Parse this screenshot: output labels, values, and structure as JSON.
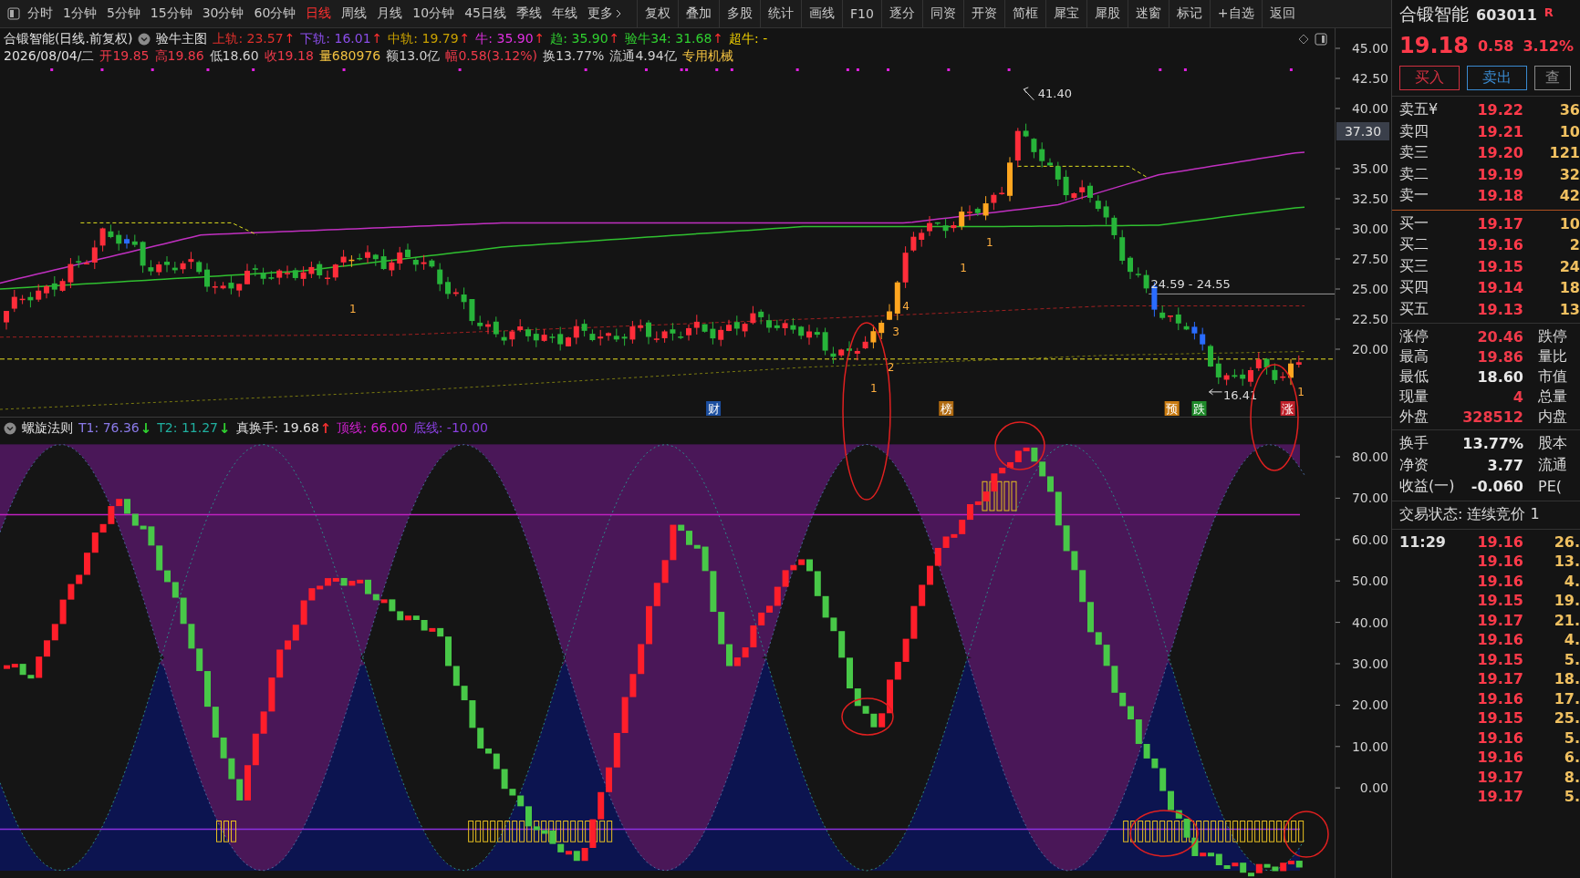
{
  "toolbar": {
    "periods": [
      {
        "label": "分时",
        "selected": false
      },
      {
        "label": "1分钟",
        "selected": false
      },
      {
        "label": "5分钟",
        "selected": false
      },
      {
        "label": "15分钟",
        "selected": false
      },
      {
        "label": "30分钟",
        "selected": false
      },
      {
        "label": "60分钟",
        "selected": false
      },
      {
        "label": "日线",
        "selected": true
      },
      {
        "label": "周线",
        "selected": false
      },
      {
        "label": "月线",
        "selected": false
      },
      {
        "label": "10分钟",
        "selected": false
      },
      {
        "label": "45日线",
        "selected": false
      },
      {
        "label": "季线",
        "selected": false
      },
      {
        "label": "年线",
        "selected": false
      },
      {
        "label": "更多",
        "selected": false
      }
    ],
    "tools": [
      "复权",
      "叠加",
      "多股",
      "统计",
      "画线",
      "F10",
      "逐分",
      "同资",
      "开资",
      "简框",
      "犀宝",
      "犀股",
      "迷窗",
      "标记",
      "+自选",
      "返回"
    ]
  },
  "price_panel": {
    "title": "合锻智能(日线.前复权)",
    "indicator_name": "验牛主图",
    "lines": [
      {
        "label": "上轨: 23.57",
        "color": "#e0302c",
        "arrow": "↑"
      },
      {
        "label": "下轨: 16.01",
        "color": "#8a4de8",
        "arrow": "↑"
      },
      {
        "label": "中轨: 19.79",
        "color": "#c8a000",
        "arrow": "↑"
      },
      {
        "label": "牛: 35.90",
        "color": "#e030e0",
        "arrow": "↑"
      },
      {
        "label": "趋: 35.90",
        "color": "#30d030",
        "arrow": "↑"
      },
      {
        "label": "验牛34: 31.68",
        "color": "#30d030",
        "arrow": "↑"
      },
      {
        "label": "超牛: -",
        "color": "#f0d000"
      }
    ],
    "date": "2026/08/04/二",
    "quote": [
      {
        "label": "开19.85",
        "color": "#f03a4a"
      },
      {
        "label": "高19.86",
        "color": "#f03a4a"
      },
      {
        "label": "低18.60",
        "color": "#d0d0d0"
      },
      {
        "label": "收19.18",
        "color": "#f03a4a"
      },
      {
        "label": "量680976",
        "color": "#f0c040"
      },
      {
        "label": "额13.0亿",
        "color": "#d0d0d0"
      },
      {
        "label": "幅0.58(3.12%)",
        "color": "#f03a4a"
      },
      {
        "label": "换13.77%",
        "color": "#d0d0d0"
      },
      {
        "label": "流通4.94亿",
        "color": "#d0d0d0"
      },
      {
        "label": "专用机械",
        "color": "#f0c040"
      }
    ],
    "axis": [
      "45.00",
      "42.50",
      "40.00",
      "35.00",
      "32.50",
      "30.00",
      "27.50",
      "25.00",
      "22.50",
      "20.00"
    ],
    "cursor_price": "37.30",
    "peak_label": "41.40",
    "range_label": "24.59 - 24.55",
    "low_label": "16.41",
    "candle_marks": [
      {
        "label": "1"
      },
      {
        "label": "4"
      },
      {
        "label": "3"
      },
      {
        "label": "2"
      },
      {
        "label": "1"
      },
      {
        "label": "1"
      },
      {
        "label": "1"
      },
      {
        "label": "1"
      }
    ],
    "events": [
      {
        "label": "财",
        "color": "#1c4fa0"
      },
      {
        "label": "榜",
        "color": "#b06a10"
      },
      {
        "label": "预",
        "color": "#c87a10"
      },
      {
        "label": "跌",
        "color": "#1f8a2a"
      },
      {
        "label": "涨",
        "color": "#c0202a"
      }
    ]
  },
  "indicator_panel": {
    "name": "螺旋法则",
    "values": [
      {
        "label": "T1: 76.36",
        "color": "#8a7ae8",
        "arrow": {
          "symbol": "↓",
          "color": "#30d030"
        }
      },
      {
        "label": "T2: 11.27",
        "color": "#20b0a0",
        "arrow": {
          "symbol": "↓",
          "color": "#30d030"
        }
      },
      {
        "label": "真换手: 19.68",
        "color": "#e0e0e0",
        "arrow": {
          "symbol": "↑",
          "color": "#f03030"
        }
      },
      {
        "label": "顶线: 66.00",
        "color": "#d020d0"
      },
      {
        "label": "底线: -10.00",
        "color": "#8a40e0"
      }
    ],
    "axis": [
      "80.00",
      "70.00",
      "60.00",
      "50.00",
      "40.00",
      "30.00",
      "20.00",
      "10.00",
      "0.00"
    ]
  },
  "quote_panel": {
    "name": "合锻智能",
    "code": "603011",
    "badge": "R",
    "price": "19.18",
    "change": "0.58",
    "percent": "3.12%",
    "buttons": [
      "买入",
      "卖出",
      "查"
    ],
    "asks": [
      {
        "label": "卖五¥",
        "price": "19.22",
        "volume": "36"
      },
      {
        "label": "卖四",
        "price": "19.21",
        "volume": "10"
      },
      {
        "label": "卖三",
        "price": "19.20",
        "volume": "121"
      },
      {
        "label": "卖二",
        "price": "19.19",
        "volume": "32"
      },
      {
        "label": "卖一",
        "price": "19.18",
        "volume": "42"
      }
    ],
    "bids": [
      {
        "label": "买一",
        "price": "19.17",
        "volume": "10"
      },
      {
        "label": "买二",
        "price": "19.16",
        "volume": "2"
      },
      {
        "label": "买三",
        "price": "19.15",
        "volume": "24"
      },
      {
        "label": "买四",
        "price": "19.14",
        "volume": "18"
      },
      {
        "label": "买五",
        "price": "19.13",
        "volume": "13"
      }
    ],
    "stats": [
      {
        "label": "涨停",
        "value": "20.46",
        "color": "#f03a4a",
        "label2": "跌停"
      },
      {
        "label": "最高",
        "value": "19.86",
        "color": "#f03a4a",
        "label2": "量比"
      },
      {
        "label": "最低",
        "value": "18.60",
        "color": "#e8e8e8",
        "label2": "市值"
      },
      {
        "label": "现量",
        "value": "4",
        "color": "#f03a4a",
        "label2": "总量"
      },
      {
        "label": "外盘",
        "value": "328512",
        "color": "#f03a4a",
        "label2": "内盘"
      }
    ],
    "stats2": [
      {
        "label": "换手",
        "value": "13.77%",
        "label2": "股本"
      },
      {
        "label": "净资",
        "value": "3.77",
        "label2": "流通"
      },
      {
        "label": "收益(一)",
        "value": "-0.060",
        "label2": "PE("
      }
    ],
    "status": "交易状态: 连续竞价 1",
    "ticks": [
      {
        "time": "11:29",
        "price": "19.16",
        "volume": "26."
      },
      {
        "price": "19.16",
        "volume": "13."
      },
      {
        "price": "19.16",
        "volume": "4."
      },
      {
        "price": "19.15",
        "volume": "19."
      },
      {
        "price": "19.17",
        "volume": "21."
      },
      {
        "price": "19.16",
        "volume": "4."
      },
      {
        "price": "19.15",
        "volume": "5."
      },
      {
        "price": "19.17",
        "volume": "18."
      },
      {
        "price": "19.16",
        "volume": "17."
      },
      {
        "price": "19.15",
        "volume": "25."
      },
      {
        "price": "19.16",
        "volume": "5."
      },
      {
        "price": "19.16",
        "volume": "6."
      },
      {
        "price": "19.17",
        "volume": "8."
      },
      {
        "price": "19.17",
        "volume": "5."
      }
    ]
  }
}
